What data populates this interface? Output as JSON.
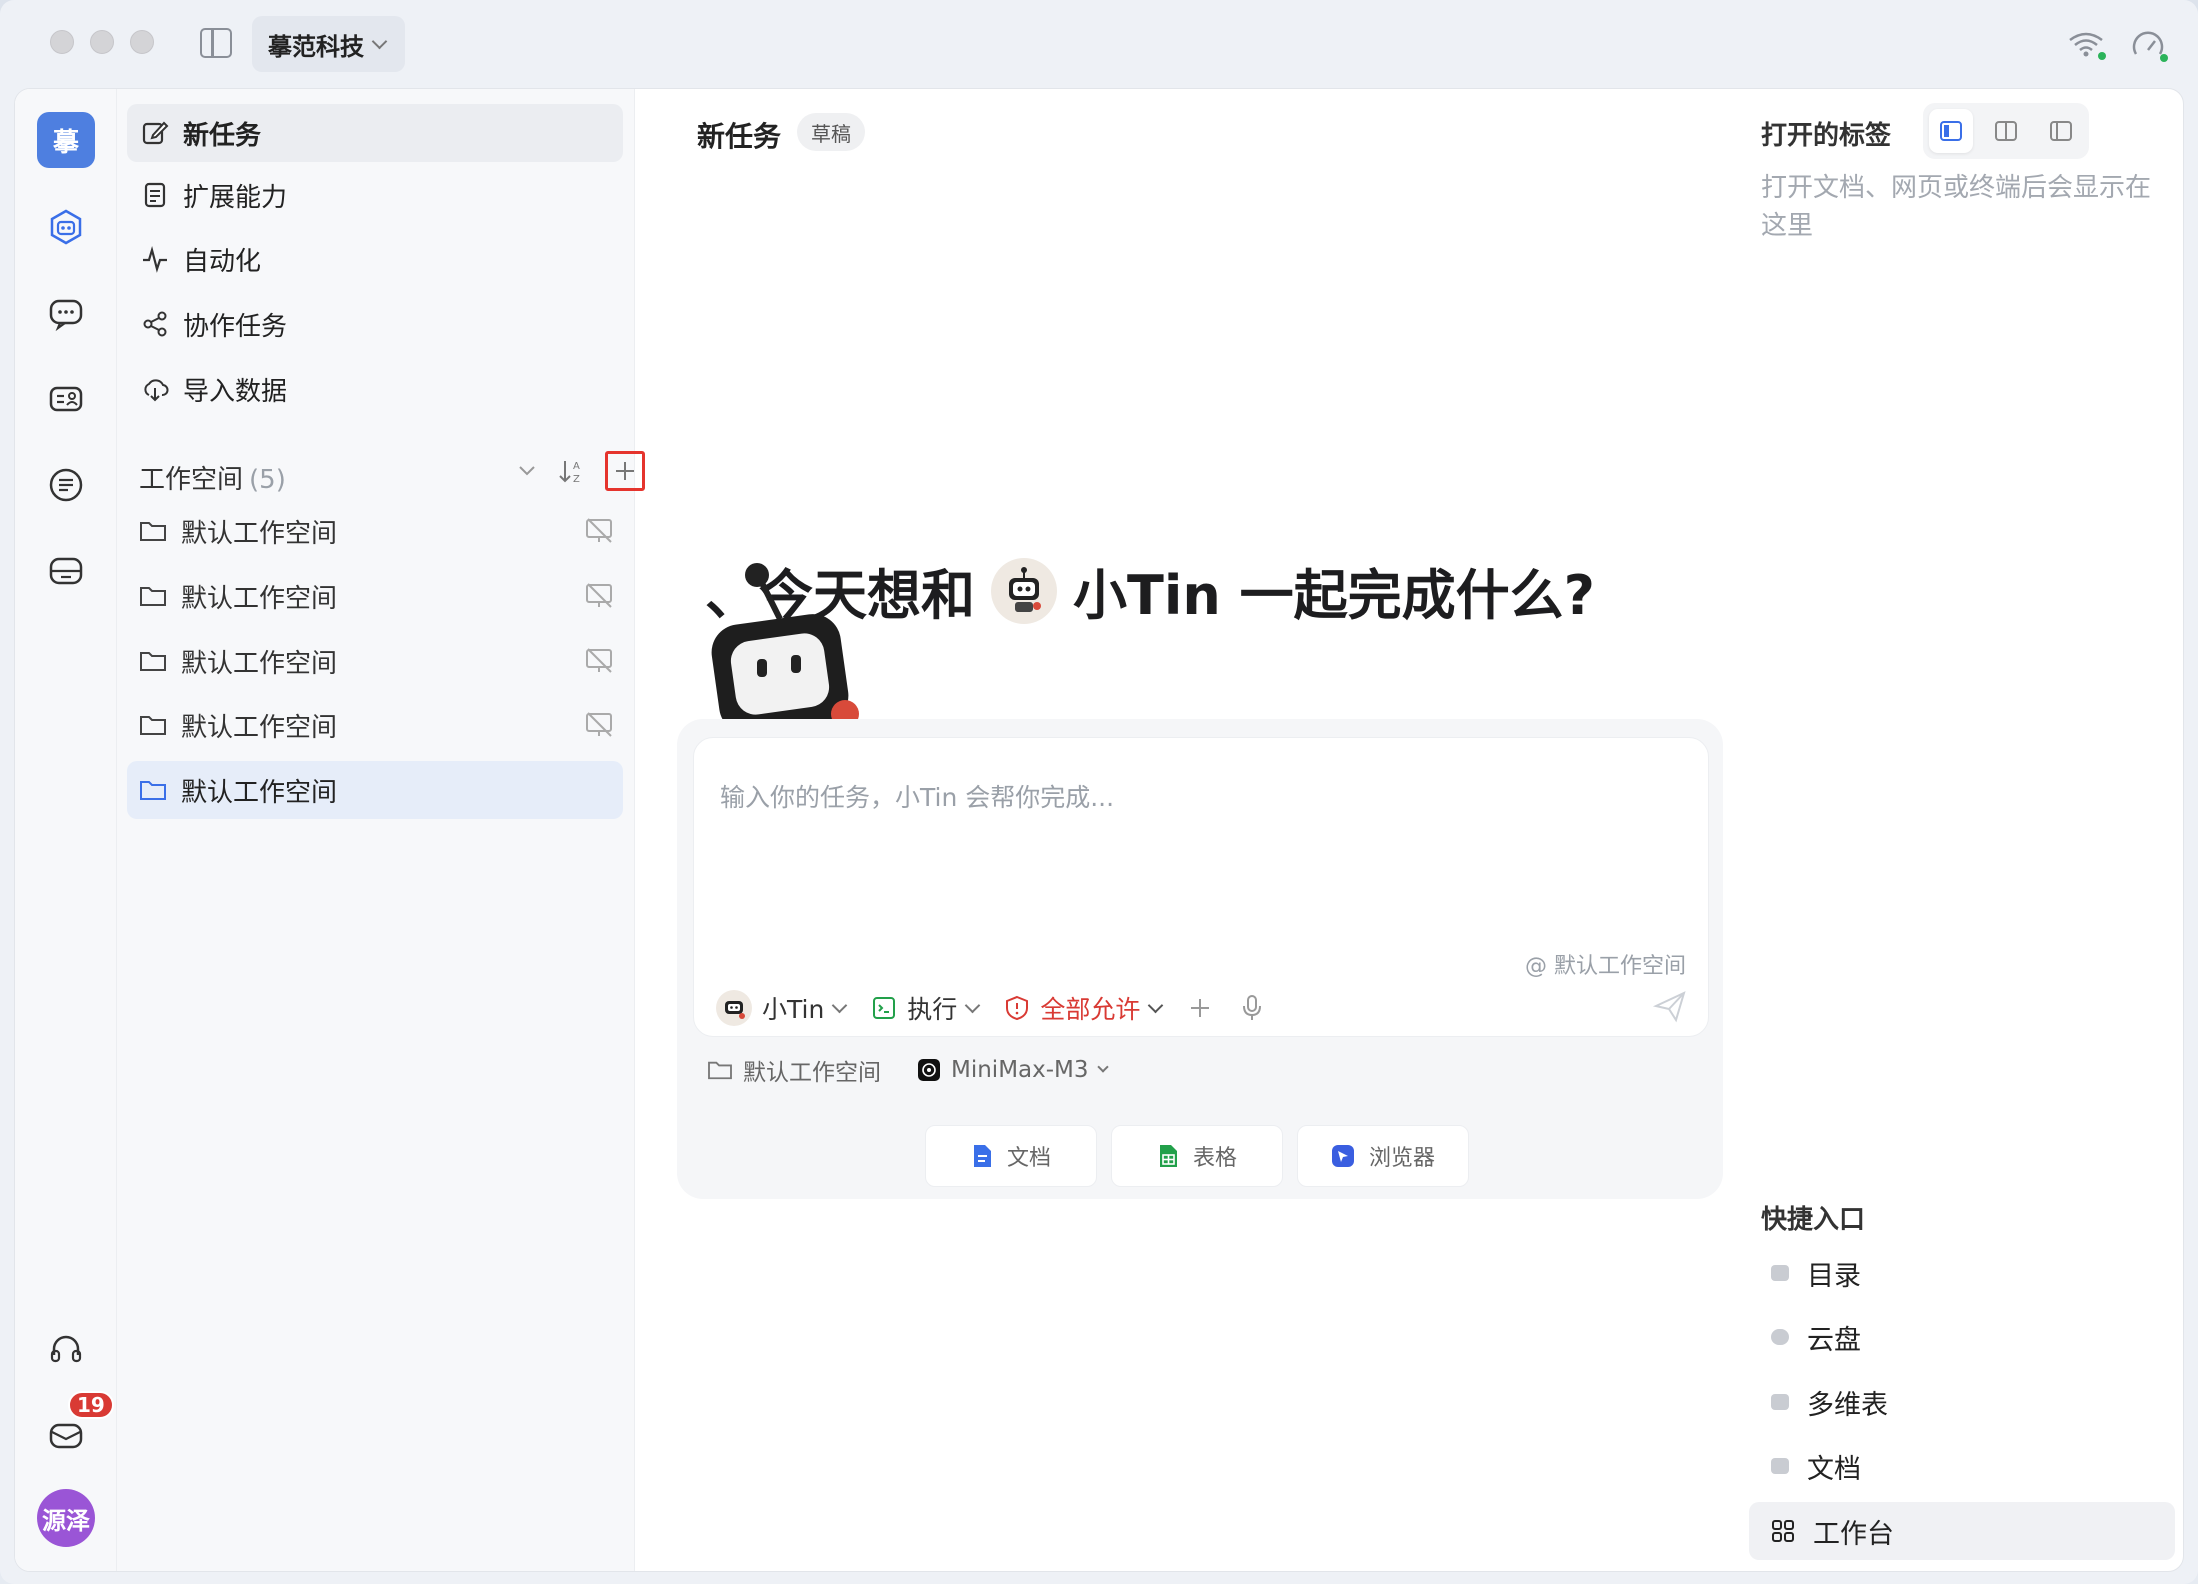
{
  "titlebar": {
    "org_name": "摹范科技"
  },
  "rail": {
    "logo_text": "摹",
    "notification_count": "19",
    "user_avatar": "源泽"
  },
  "sidebar": {
    "nav": [
      {
        "label": "新任务",
        "icon": "edit-icon"
      },
      {
        "label": "扩展能力",
        "icon": "document-icon"
      },
      {
        "label": "自动化",
        "icon": "activity-icon"
      },
      {
        "label": "协作任务",
        "icon": "share-icon"
      },
      {
        "label": "导入数据",
        "icon": "cloud-download-icon"
      }
    ],
    "workspaces_title": "工作空间",
    "workspaces_count": "(5)",
    "workspaces": [
      {
        "label": "默认工作空间"
      },
      {
        "label": "默认工作空间"
      },
      {
        "label": "默认工作空间"
      },
      {
        "label": "默认工作空间"
      },
      {
        "label": "默认工作空间"
      }
    ]
  },
  "main": {
    "task_title": "新任务",
    "draft_badge": "草稿",
    "hero_prefix": "、今天想和",
    "hero_suffix": "小Tin 一起完成什么?",
    "composer": {
      "placeholder": "输入你的任务，小Tin 会帮你完成...",
      "mention_workspace": "@ 默认工作空间",
      "agent": "小Tin",
      "mode": "执行",
      "permission": "全部允许"
    },
    "footer": {
      "workspace": "默认工作空间",
      "model": "MiniMax-M3"
    },
    "chips": [
      {
        "label": "文档",
        "icon": "doc-icon",
        "color": "#3a6fe8"
      },
      {
        "label": "表格",
        "icon": "sheet-icon",
        "color": "#22a04a"
      },
      {
        "label": "浏览器",
        "icon": "browser-icon",
        "color": "#3a5ee0"
      }
    ]
  },
  "right_panel": {
    "open_tabs_title": "打开的标签",
    "open_tabs_desc": "打开文档、网页或终端后会显示在这里",
    "quick_title": "快捷入口",
    "quick_items": [
      {
        "label": "目录",
        "icon": "folder-icon"
      },
      {
        "label": "云盘",
        "icon": "cloud-icon"
      },
      {
        "label": "多维表",
        "icon": "table-icon"
      },
      {
        "label": "文档",
        "icon": "file-icon"
      },
      {
        "label": "工作台",
        "icon": "grid-icon"
      }
    ]
  },
  "colors": {
    "accent": "#4e7fe0",
    "danger": "#d93a34",
    "highlight": "#e5342d"
  }
}
